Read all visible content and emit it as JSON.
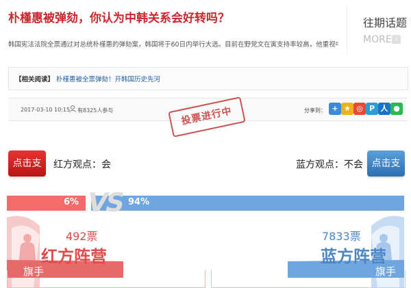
{
  "article": {
    "title": "朴槿惠被弹劾，你认为中韩关系会好转吗？",
    "summary": "韩国宪法法院全票通过对总统朴槿惠的弹劾案，韩国将于60日内举行大选。目前在野党文在寅支持率较高，他重视中韩关系。",
    "related_label": "【相关阅读】",
    "related_link": "朴槿惠被全票弹劾！开韩国历史先河",
    "date": "2017-03-10 10:15",
    "participants": "有8325人参与",
    "stamp": "投票进行中",
    "share_label": "分享到："
  },
  "history": {
    "title": "往期话题",
    "more": "MORE"
  },
  "share_icons": [
    {
      "name": "share-plus-icon",
      "glyph": "+",
      "color": "#3b8bd8"
    },
    {
      "name": "share-star-icon",
      "glyph": "★",
      "color": "#f2b01e"
    },
    {
      "name": "share-weibo-icon",
      "glyph": "◎",
      "color": "#e94a38"
    },
    {
      "name": "share-qqzone-icon",
      "glyph": "P",
      "color": "#2b9ed8"
    },
    {
      "name": "share-renren-icon",
      "glyph": "人",
      "color": "#1b73c8"
    },
    {
      "name": "share-wechat-icon",
      "glyph": "●",
      "color": "#2db84d"
    }
  ],
  "vote": {
    "red_button": "点击支持",
    "blue_button": "点击支持",
    "red_view": "红方观点：会",
    "blue_view": "蓝方观点：不会",
    "red_percent": "6%",
    "blue_percent": "94%",
    "red_fraction": 0.06,
    "blue_fraction": 0.94,
    "vs": "VS",
    "red_votes": "492票",
    "blue_votes": "7833票",
    "red_camp": "红方阵营",
    "blue_camp": "蓝方阵营",
    "red_flag": "旗手",
    "blue_flag": "旗手"
  },
  "colors": {
    "red": "#e14a4a",
    "blue": "#4c86c7"
  }
}
